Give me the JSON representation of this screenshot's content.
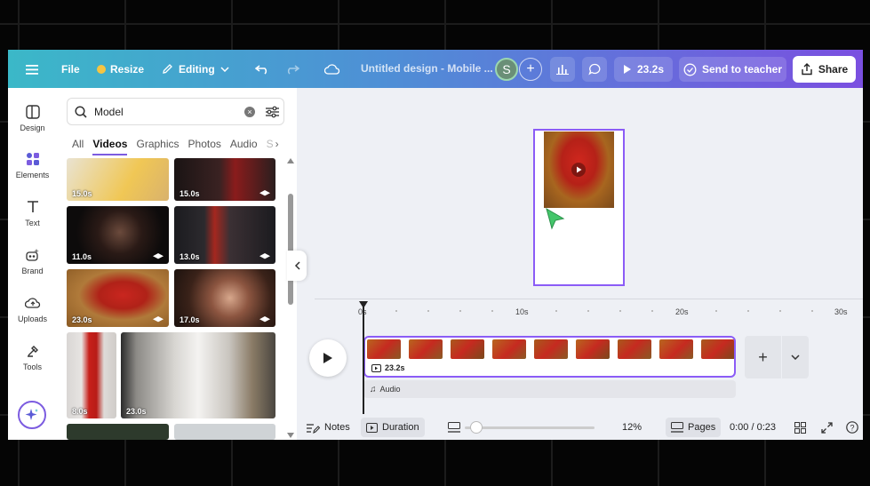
{
  "topbar": {
    "file_label": "File",
    "resize_label": "Resize",
    "editing_label": "Editing",
    "doc_title": "Untitled design - Mobile ...",
    "avatar_letter": "S",
    "play_duration": "23.2s",
    "send_to_teacher_label": "Send to teacher",
    "share_label": "Share"
  },
  "rail": {
    "items": [
      {
        "label": "Design",
        "icon": "design-icon"
      },
      {
        "label": "Elements",
        "icon": "elements-icon"
      },
      {
        "label": "Text",
        "icon": "text-icon"
      },
      {
        "label": "Brand",
        "icon": "brand-icon"
      },
      {
        "label": "Uploads",
        "icon": "uploads-icon"
      },
      {
        "label": "Tools",
        "icon": "tools-icon"
      }
    ]
  },
  "panel": {
    "search_value": "Model",
    "tabs": [
      "All",
      "Videos",
      "Graphics",
      "Photos",
      "Audio",
      "S"
    ],
    "active_tab": "Videos",
    "tiles": [
      {
        "duration": "15.0s"
      },
      {
        "duration": "15.0s"
      },
      {
        "duration": "11.0s"
      },
      {
        "duration": "13.0s"
      },
      {
        "duration": "23.0s"
      },
      {
        "duration": "17.0s"
      },
      {
        "duration": "8.0s"
      },
      {
        "duration": "23.0s"
      }
    ]
  },
  "timeline": {
    "ruler": [
      "0s",
      "10s",
      "20s",
      "30s"
    ],
    "clip_duration": "23.2s",
    "audio_label": "Audio"
  },
  "bottombar": {
    "notes_label": "Notes",
    "duration_label": "Duration",
    "zoom": "12%",
    "pages_label": "Pages",
    "time": "0:00 / 0:23"
  },
  "colors": {
    "accent": "#8b5cf6",
    "red_dress": "#c42a22"
  }
}
